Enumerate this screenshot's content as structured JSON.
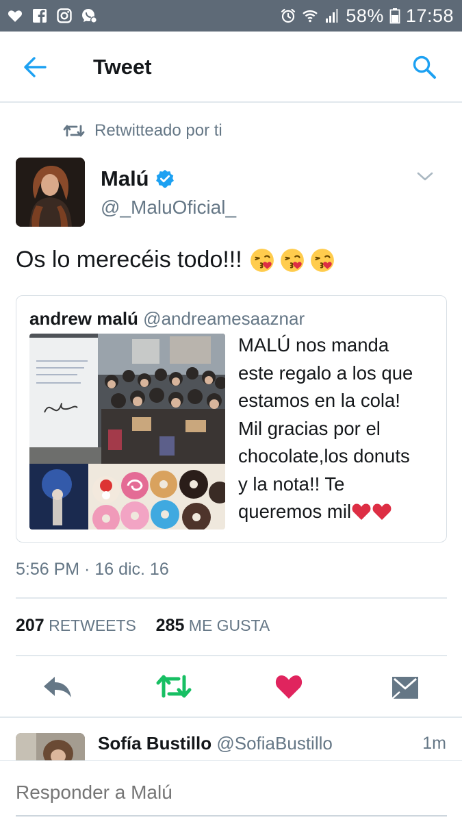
{
  "status_bar": {
    "left_icons": [
      "heart-icon",
      "facebook-icon",
      "instagram-icon",
      "whatsapp-icon"
    ],
    "right_icons": [
      "alarm-icon",
      "wifi-icon",
      "signal-icon",
      "battery-icon"
    ],
    "battery": "58%",
    "time": "17:58"
  },
  "app_bar": {
    "title": "Tweet",
    "back_icon": "back-arrow-icon",
    "search_icon": "search-icon"
  },
  "tweet": {
    "retweet_context": "Retwitteado por ti",
    "author_name": "Malú",
    "author_handle": "@_MaluOficial_",
    "verified": true,
    "text": "Os lo merecéis todo!!!",
    "emoji_count": 3,
    "quoted": {
      "name": "andrew malú",
      "handle": "@andreamesaaznar",
      "text_lines": [
        "MALÚ nos manda",
        "este regalo a los que",
        "estamos en la cola!",
        "Mil gracias por el",
        "chocolate,los donuts",
        "y la nota!! Te",
        "queremos mil"
      ]
    },
    "timestamp": "5:56 PM · 16 dic. 16",
    "retweets_count": "207",
    "retweets_label": "RETWEETS",
    "likes_count": "285",
    "likes_label": "ME GUSTA"
  },
  "actions": [
    "reply-icon",
    "retweet-icon",
    "like-icon",
    "direct-message-icon"
  ],
  "reply_preview": {
    "name": "Sofía Bustillo",
    "handle": "@SofiaBustillo",
    "time": "1m"
  },
  "composer": {
    "placeholder": "Responder a Malú"
  },
  "colors": {
    "status_bar": "#5e6a77",
    "twitter_blue": "#1da1f2",
    "retweet_green": "#17bf63",
    "like_red": "#e0245e",
    "secondary_text": "#657786"
  }
}
